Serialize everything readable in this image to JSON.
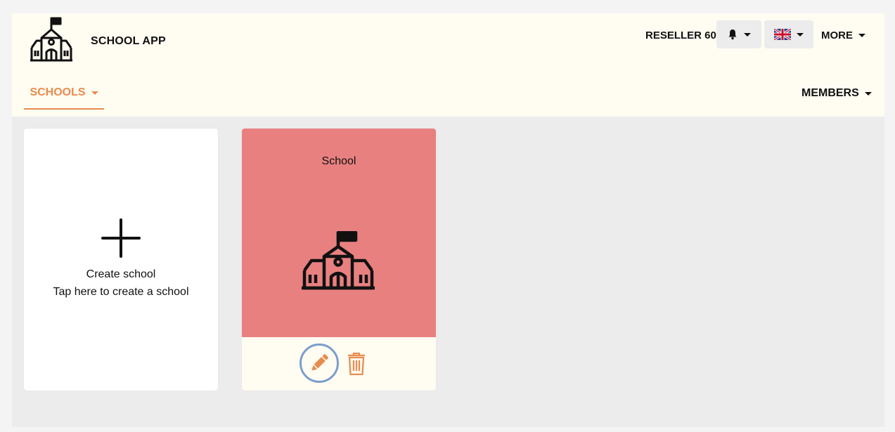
{
  "header": {
    "app_title": "SCHOOL APP",
    "reseller": "RESELLER 60",
    "more_label": "MORE",
    "icons": {
      "logo": "school-building-icon",
      "notifications": "bell-icon",
      "language": "uk-flag-icon"
    }
  },
  "nav": {
    "schools_label": "SCHOOLS",
    "members_label": "MEMBERS"
  },
  "cards": {
    "create": {
      "title": "Create school",
      "subtitle": "Tap here to create a school",
      "icon": "plus-icon"
    },
    "school": {
      "name": "School",
      "icon": "school-building-icon",
      "edit_icon": "pencil-icon",
      "delete_icon": "trash-icon"
    }
  },
  "colors": {
    "accent": "#e88b4c",
    "header_bg": "#fffcf2",
    "school_card_bg": "#e98080",
    "edit_ring": "#7a9ecb"
  }
}
